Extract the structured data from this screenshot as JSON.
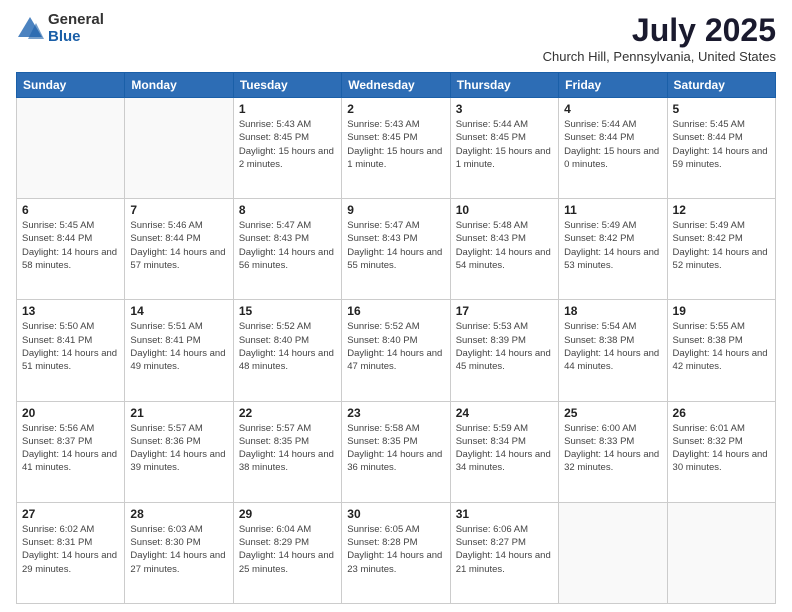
{
  "header": {
    "logo_general": "General",
    "logo_blue": "Blue",
    "title": "July 2025",
    "subtitle": "Church Hill, Pennsylvania, United States"
  },
  "days_of_week": [
    "Sunday",
    "Monday",
    "Tuesday",
    "Wednesday",
    "Thursday",
    "Friday",
    "Saturday"
  ],
  "weeks": [
    [
      {
        "day": "",
        "info": ""
      },
      {
        "day": "",
        "info": ""
      },
      {
        "day": "1",
        "info": "Sunrise: 5:43 AM\nSunset: 8:45 PM\nDaylight: 15 hours\nand 2 minutes."
      },
      {
        "day": "2",
        "info": "Sunrise: 5:43 AM\nSunset: 8:45 PM\nDaylight: 15 hours\nand 1 minute."
      },
      {
        "day": "3",
        "info": "Sunrise: 5:44 AM\nSunset: 8:45 PM\nDaylight: 15 hours\nand 1 minute."
      },
      {
        "day": "4",
        "info": "Sunrise: 5:44 AM\nSunset: 8:44 PM\nDaylight: 15 hours\nand 0 minutes."
      },
      {
        "day": "5",
        "info": "Sunrise: 5:45 AM\nSunset: 8:44 PM\nDaylight: 14 hours\nand 59 minutes."
      }
    ],
    [
      {
        "day": "6",
        "info": "Sunrise: 5:45 AM\nSunset: 8:44 PM\nDaylight: 14 hours\nand 58 minutes."
      },
      {
        "day": "7",
        "info": "Sunrise: 5:46 AM\nSunset: 8:44 PM\nDaylight: 14 hours\nand 57 minutes."
      },
      {
        "day": "8",
        "info": "Sunrise: 5:47 AM\nSunset: 8:43 PM\nDaylight: 14 hours\nand 56 minutes."
      },
      {
        "day": "9",
        "info": "Sunrise: 5:47 AM\nSunset: 8:43 PM\nDaylight: 14 hours\nand 55 minutes."
      },
      {
        "day": "10",
        "info": "Sunrise: 5:48 AM\nSunset: 8:43 PM\nDaylight: 14 hours\nand 54 minutes."
      },
      {
        "day": "11",
        "info": "Sunrise: 5:49 AM\nSunset: 8:42 PM\nDaylight: 14 hours\nand 53 minutes."
      },
      {
        "day": "12",
        "info": "Sunrise: 5:49 AM\nSunset: 8:42 PM\nDaylight: 14 hours\nand 52 minutes."
      }
    ],
    [
      {
        "day": "13",
        "info": "Sunrise: 5:50 AM\nSunset: 8:41 PM\nDaylight: 14 hours\nand 51 minutes."
      },
      {
        "day": "14",
        "info": "Sunrise: 5:51 AM\nSunset: 8:41 PM\nDaylight: 14 hours\nand 49 minutes."
      },
      {
        "day": "15",
        "info": "Sunrise: 5:52 AM\nSunset: 8:40 PM\nDaylight: 14 hours\nand 48 minutes."
      },
      {
        "day": "16",
        "info": "Sunrise: 5:52 AM\nSunset: 8:40 PM\nDaylight: 14 hours\nand 47 minutes."
      },
      {
        "day": "17",
        "info": "Sunrise: 5:53 AM\nSunset: 8:39 PM\nDaylight: 14 hours\nand 45 minutes."
      },
      {
        "day": "18",
        "info": "Sunrise: 5:54 AM\nSunset: 8:38 PM\nDaylight: 14 hours\nand 44 minutes."
      },
      {
        "day": "19",
        "info": "Sunrise: 5:55 AM\nSunset: 8:38 PM\nDaylight: 14 hours\nand 42 minutes."
      }
    ],
    [
      {
        "day": "20",
        "info": "Sunrise: 5:56 AM\nSunset: 8:37 PM\nDaylight: 14 hours\nand 41 minutes."
      },
      {
        "day": "21",
        "info": "Sunrise: 5:57 AM\nSunset: 8:36 PM\nDaylight: 14 hours\nand 39 minutes."
      },
      {
        "day": "22",
        "info": "Sunrise: 5:57 AM\nSunset: 8:35 PM\nDaylight: 14 hours\nand 38 minutes."
      },
      {
        "day": "23",
        "info": "Sunrise: 5:58 AM\nSunset: 8:35 PM\nDaylight: 14 hours\nand 36 minutes."
      },
      {
        "day": "24",
        "info": "Sunrise: 5:59 AM\nSunset: 8:34 PM\nDaylight: 14 hours\nand 34 minutes."
      },
      {
        "day": "25",
        "info": "Sunrise: 6:00 AM\nSunset: 8:33 PM\nDaylight: 14 hours\nand 32 minutes."
      },
      {
        "day": "26",
        "info": "Sunrise: 6:01 AM\nSunset: 8:32 PM\nDaylight: 14 hours\nand 30 minutes."
      }
    ],
    [
      {
        "day": "27",
        "info": "Sunrise: 6:02 AM\nSunset: 8:31 PM\nDaylight: 14 hours\nand 29 minutes."
      },
      {
        "day": "28",
        "info": "Sunrise: 6:03 AM\nSunset: 8:30 PM\nDaylight: 14 hours\nand 27 minutes."
      },
      {
        "day": "29",
        "info": "Sunrise: 6:04 AM\nSunset: 8:29 PM\nDaylight: 14 hours\nand 25 minutes."
      },
      {
        "day": "30",
        "info": "Sunrise: 6:05 AM\nSunset: 8:28 PM\nDaylight: 14 hours\nand 23 minutes."
      },
      {
        "day": "31",
        "info": "Sunrise: 6:06 AM\nSunset: 8:27 PM\nDaylight: 14 hours\nand 21 minutes."
      },
      {
        "day": "",
        "info": ""
      },
      {
        "day": "",
        "info": ""
      }
    ]
  ]
}
